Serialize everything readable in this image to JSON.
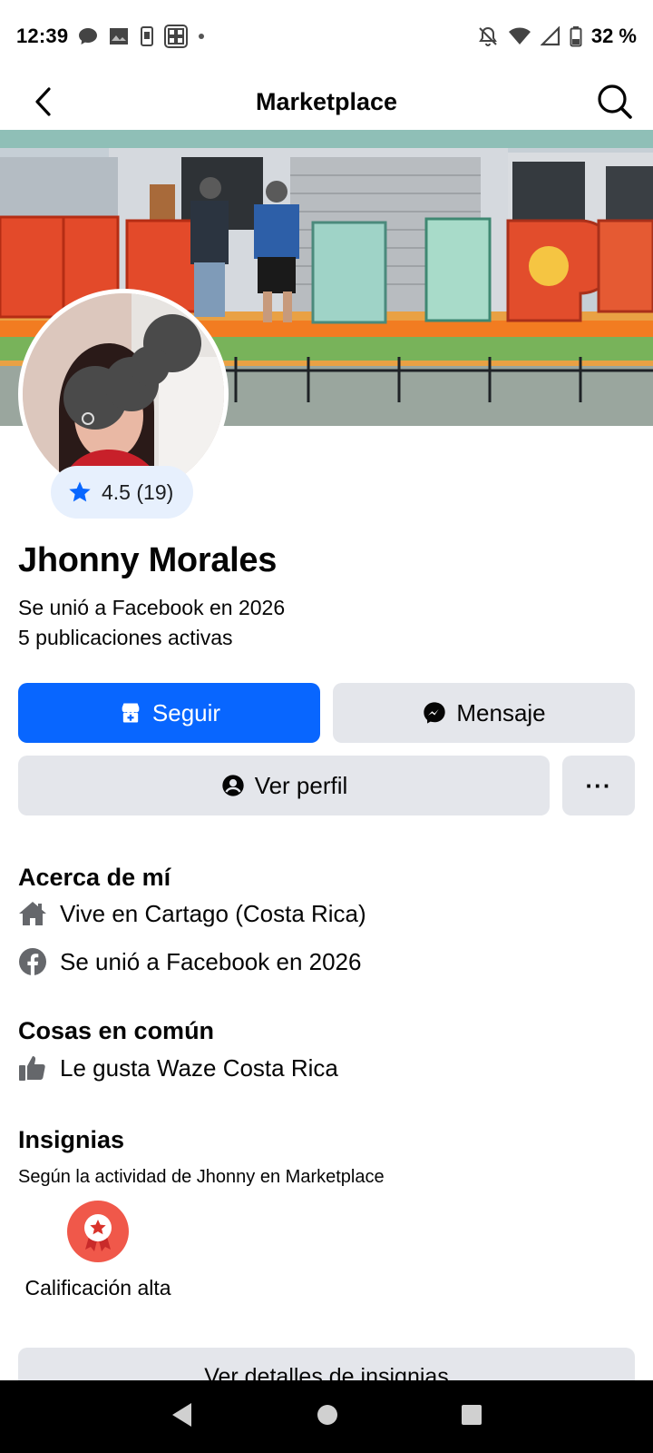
{
  "status_bar": {
    "time": "12:39",
    "battery_text": "32 %"
  },
  "nav": {
    "title": "Marketplace"
  },
  "profile": {
    "rating": "4.5 (19)",
    "name": "Jhonny Morales",
    "joined": "Se unió a Facebook en 2026",
    "active_listings": "5 publicaciones activas"
  },
  "actions": {
    "follow_label": "Seguir",
    "message_label": "Mensaje",
    "view_profile_label": "Ver perfil",
    "more_label": "···"
  },
  "about": {
    "title": "Acerca de mí",
    "items": [
      {
        "icon": "home-icon",
        "text": "Vive en Cartago (Costa Rica)"
      },
      {
        "icon": "facebook-icon",
        "text": "Se unió a Facebook en 2026"
      }
    ]
  },
  "common": {
    "title": "Cosas en común",
    "items": [
      {
        "icon": "thumbs-up-icon",
        "text": "Le gusta Waze Costa Rica"
      }
    ]
  },
  "badges": {
    "title": "Insignias",
    "subtitle": "Según la actividad de Jhonny en Marketplace",
    "items": [
      {
        "icon": "star-medal-icon",
        "label": "Calificación alta"
      }
    ],
    "details_button": "Ver detalles de insignias"
  },
  "colors": {
    "primary": "#0866ff",
    "secondary_button": "#e4e6eb",
    "rating_badge_bg": "#e7f0fd",
    "badge_red": "#f0584a"
  }
}
